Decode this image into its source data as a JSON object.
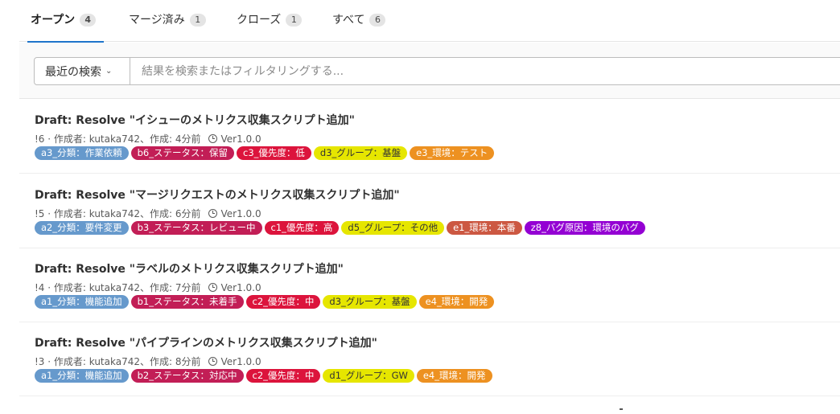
{
  "tabs": [
    {
      "label": "オープン",
      "count": "4"
    },
    {
      "label": "マージ済み",
      "count": "1"
    },
    {
      "label": "クローズ",
      "count": "1"
    },
    {
      "label": "すべて",
      "count": "6"
    }
  ],
  "filter": {
    "recent_label": "最近の検索",
    "search_placeholder": "結果を検索またはフィルタリングする..."
  },
  "colors": {
    "accent": "#1f75cb",
    "blue": "#6699cc",
    "magenta": "#c21e56",
    "red": "#dc143c",
    "yellow": "#e6e600",
    "orange": "#ed9121",
    "brown": "#cc5842",
    "purple": "#9400d3"
  },
  "merge_requests": [
    {
      "title": "Draft: Resolve \"イシューのメトリクス収集スクリプト追加\"",
      "meta": "!6 · 作成者: kutaka742、作成: 4分前",
      "milestone": "Ver1.0.0",
      "labels": [
        {
          "text": "a3_分類：作業依頼",
          "color": "#6699cc",
          "dark": false
        },
        {
          "text": "b6_ステータス：保留",
          "color": "#c21e56",
          "dark": false
        },
        {
          "text": "c3_優先度：低",
          "color": "#dc143c",
          "dark": false
        },
        {
          "text": "d3_グループ：基盤",
          "color": "#e6e600",
          "dark": true
        },
        {
          "text": "e3_環境：テスト",
          "color": "#ed9121",
          "dark": false
        }
      ]
    },
    {
      "title": "Draft: Resolve \"マージリクエストのメトリクス収集スクリプト追加\"",
      "meta": "!5 · 作成者: kutaka742、作成: 6分前",
      "milestone": "Ver1.0.0",
      "labels": [
        {
          "text": "a2_分類：要件変更",
          "color": "#6699cc",
          "dark": false
        },
        {
          "text": "b3_ステータス：レビュー中",
          "color": "#c21e56",
          "dark": false
        },
        {
          "text": "c1_優先度：高",
          "color": "#dc143c",
          "dark": false
        },
        {
          "text": "d5_グループ：その他",
          "color": "#e6e600",
          "dark": true
        },
        {
          "text": "e1_環境：本番",
          "color": "#cc5842",
          "dark": false
        },
        {
          "text": "z8_バグ原因：環境のバグ",
          "color": "#9400d3",
          "dark": false
        }
      ]
    },
    {
      "title": "Draft: Resolve \"ラベルのメトリクス収集スクリプト追加\"",
      "meta": "!4 · 作成者: kutaka742、作成: 7分前",
      "milestone": "Ver1.0.0",
      "labels": [
        {
          "text": "a1_分類：機能追加",
          "color": "#6699cc",
          "dark": false
        },
        {
          "text": "b1_ステータス：未着手",
          "color": "#c21e56",
          "dark": false
        },
        {
          "text": "c2_優先度：中",
          "color": "#dc143c",
          "dark": false
        },
        {
          "text": "d3_グループ：基盤",
          "color": "#e6e600",
          "dark": true
        },
        {
          "text": "e4_環境：開発",
          "color": "#ed9121",
          "dark": false
        }
      ]
    },
    {
      "title": "Draft: Resolve \"パイプラインのメトリクス収集スクリプト追加\"",
      "meta": "!3 · 作成者: kutaka742、作成: 8分前",
      "milestone": "Ver1.0.0",
      "labels": [
        {
          "text": "a1_分類：機能追加",
          "color": "#6699cc",
          "dark": false
        },
        {
          "text": "b2_ステータス：対応中",
          "color": "#c21e56",
          "dark": false
        },
        {
          "text": "c2_優先度：中",
          "color": "#dc143c",
          "dark": false
        },
        {
          "text": "d1_グループ：GW",
          "color": "#e6e600",
          "dark": true
        },
        {
          "text": "e4_環境：開発",
          "color": "#ed9121",
          "dark": false
        }
      ]
    }
  ]
}
